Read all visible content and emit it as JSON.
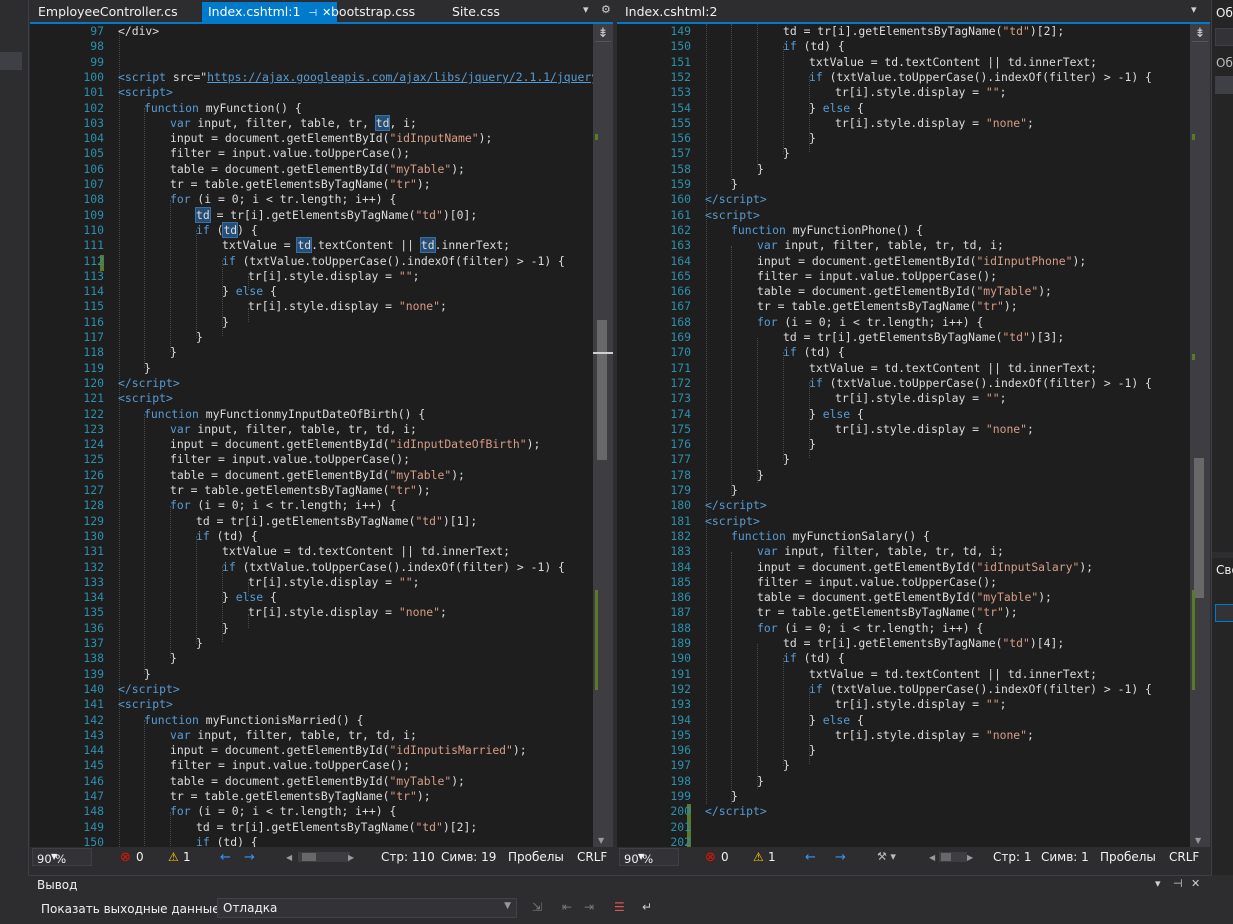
{
  "left_editor": {
    "tabs": [
      {
        "label": "EmployeeController.cs",
        "active": false
      },
      {
        "label": "Index.cshtml:1",
        "active": true,
        "pin": "⊣",
        "close": "✕"
      },
      {
        "label": "bootstrap.css",
        "active": false
      },
      {
        "label": "Site.css",
        "active": false
      }
    ],
    "line_numbers": [
      "97",
      "98",
      "99",
      "100",
      "101",
      "102",
      "103",
      "104",
      "105",
      "106",
      "107",
      "108",
      "109",
      "110",
      "111",
      "112",
      "113",
      "114",
      "115",
      "116",
      "117",
      "118",
      "119",
      "120",
      "121",
      "122",
      "123",
      "124",
      "125",
      "126",
      "127",
      "128",
      "129",
      "130",
      "131",
      "132",
      "133",
      "134",
      "135",
      "136",
      "137",
      "138",
      "139",
      "140",
      "141",
      "142",
      "143",
      "144",
      "145",
      "146",
      "147",
      "148",
      "149",
      "150"
    ],
    "status": {
      "zoom": "90 %",
      "errors": "0",
      "warnings": "1",
      "line": "Стр: 110",
      "col": "Симв: 19",
      "spaces": "Пробелы",
      "eol": "CRLF"
    }
  },
  "right_editor": {
    "tabs": [
      {
        "label": "Index.cshtml:2",
        "active": false
      }
    ],
    "line_numbers": [
      "149",
      "150",
      "151",
      "152",
      "153",
      "154",
      "155",
      "156",
      "157",
      "158",
      "159",
      "160",
      "161",
      "162",
      "163",
      "164",
      "165",
      "166",
      "167",
      "168",
      "169",
      "170",
      "171",
      "172",
      "173",
      "174",
      "175",
      "176",
      "177",
      "178",
      "179",
      "180",
      "181",
      "182",
      "183",
      "184",
      "185",
      "186",
      "187",
      "188",
      "189",
      "190",
      "191",
      "192",
      "193",
      "194",
      "195",
      "196",
      "197",
      "198",
      "199",
      "200",
      "201",
      "202"
    ],
    "status": {
      "zoom": "90 %",
      "errors": "0",
      "warnings": "1",
      "line": "Стр: 1",
      "col": "Симв: 1",
      "spaces": "Пробелы",
      "eol": "CRLF"
    }
  },
  "right_panel": {
    "title_fragment": "Об",
    "search_fragment": "Об",
    "properties_fragment": "Сво"
  },
  "output_panel": {
    "title": "Вывод",
    "show_output_label": "Показать выходные данные из:",
    "source_value": "Отладка"
  }
}
